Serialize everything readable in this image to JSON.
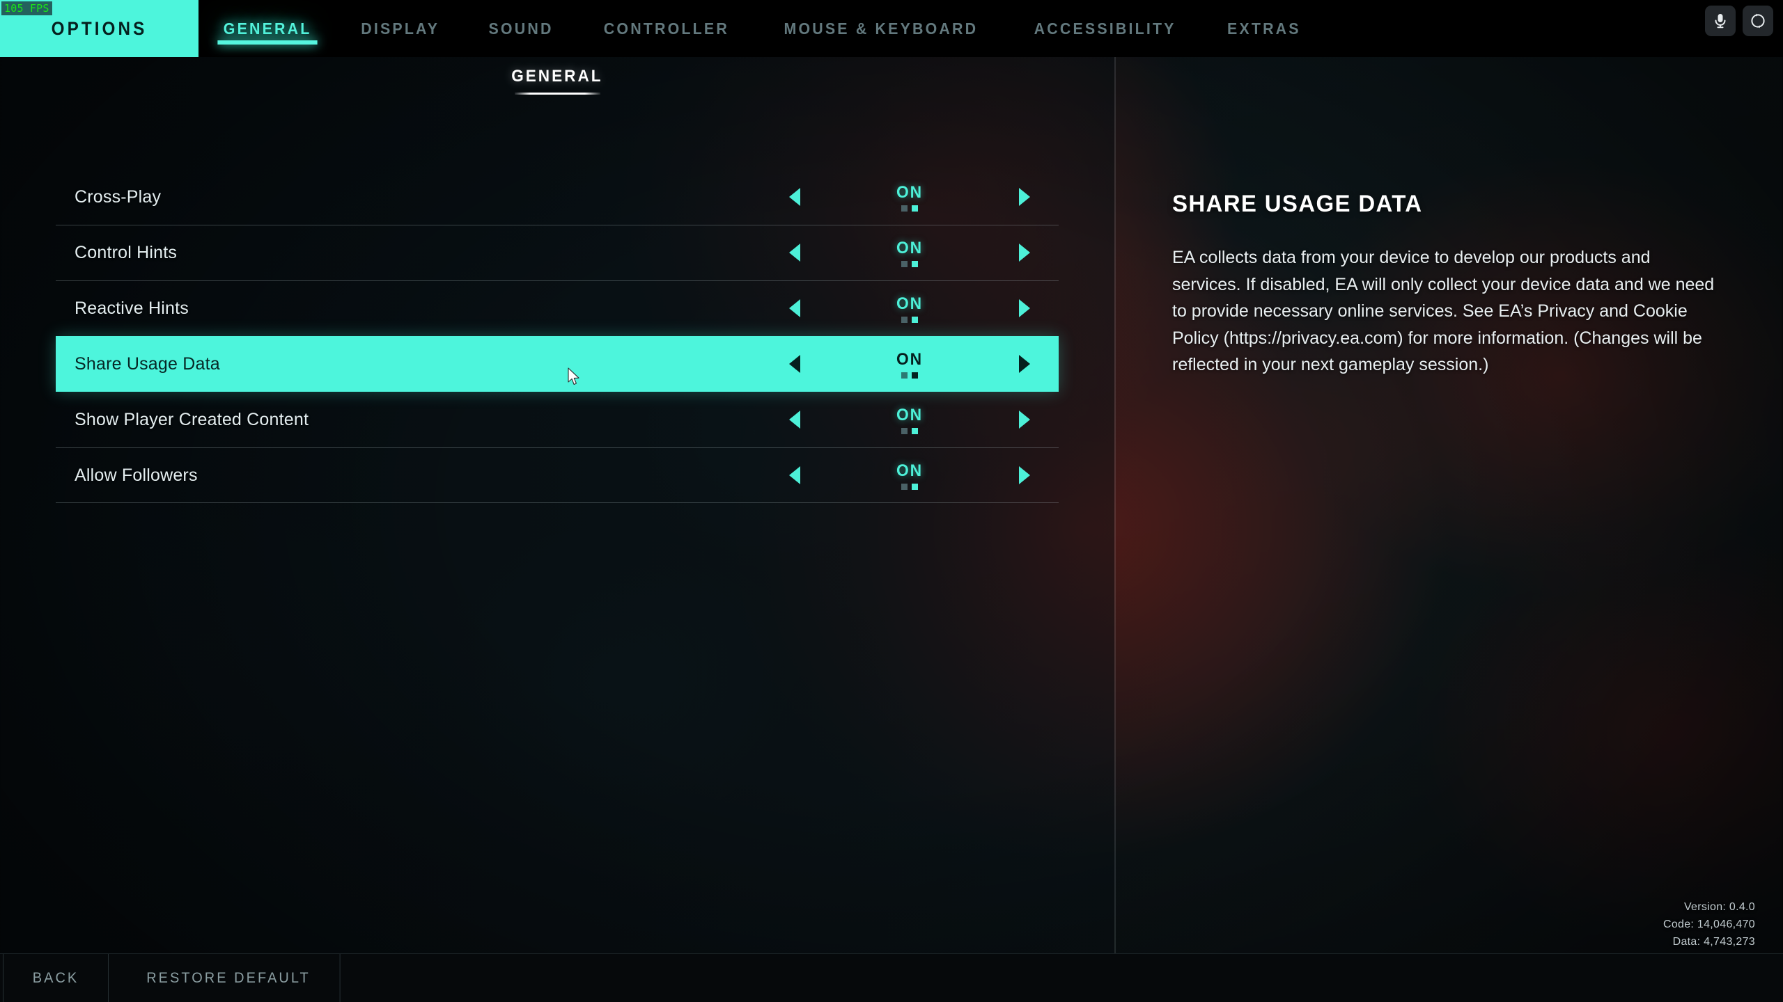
{
  "overlay": {
    "fps": "105 FPS"
  },
  "header": {
    "badge": "OPTIONS",
    "tabs": [
      {
        "label": "GENERAL",
        "active": true
      },
      {
        "label": "DISPLAY",
        "active": false
      },
      {
        "label": "SOUND",
        "active": false
      },
      {
        "label": "CONTROLLER",
        "active": false
      },
      {
        "label": "MOUSE & KEYBOARD",
        "active": false
      },
      {
        "label": "ACCESSIBILITY",
        "active": false
      },
      {
        "label": "EXTRAS",
        "active": false
      }
    ],
    "icons": [
      {
        "name": "microphone-icon"
      },
      {
        "name": "sync-circle-icon"
      }
    ]
  },
  "subheader": {
    "title": "GENERAL"
  },
  "options": {
    "rows": [
      {
        "label": "Cross-Play",
        "value": "ON",
        "dot_index": 1,
        "selected": false
      },
      {
        "label": "Control Hints",
        "value": "ON",
        "dot_index": 1,
        "selected": false
      },
      {
        "label": "Reactive Hints",
        "value": "ON",
        "dot_index": 1,
        "selected": false
      },
      {
        "label": "Share Usage Data",
        "value": "ON",
        "dot_index": 1,
        "selected": true
      },
      {
        "label": "Show Player Created Content",
        "value": "ON",
        "dot_index": 1,
        "selected": false
      },
      {
        "label": "Allow Followers",
        "value": "ON",
        "dot_index": 1,
        "selected": false
      }
    ],
    "dot_count": 2,
    "arrow_left_name": "decrement-arrow",
    "arrow_right_name": "increment-arrow"
  },
  "description": {
    "title": "SHARE USAGE DATA",
    "body": "EA collects data from your device to develop our products and services. If disabled, EA will only collect your device data and we need to provide necessary online services. See EA’s Privacy and Cookie Policy (https://privacy.ea.com) for more information. (Changes will be reflected in your next gameplay session.)"
  },
  "version": {
    "line1": "Version: 0.4.0",
    "line2": "Code: 14,046,470",
    "line3": "Data: 4,743,273"
  },
  "footer": {
    "buttons": [
      {
        "label": "BACK"
      },
      {
        "label": "RESTORE DEFAULT"
      }
    ]
  },
  "colors": {
    "accent": "#4df5dc",
    "accent_text": "#4df0d8",
    "tab_inactive": "#63797e",
    "background": "#0b1418",
    "fps_text": "#19e619"
  }
}
